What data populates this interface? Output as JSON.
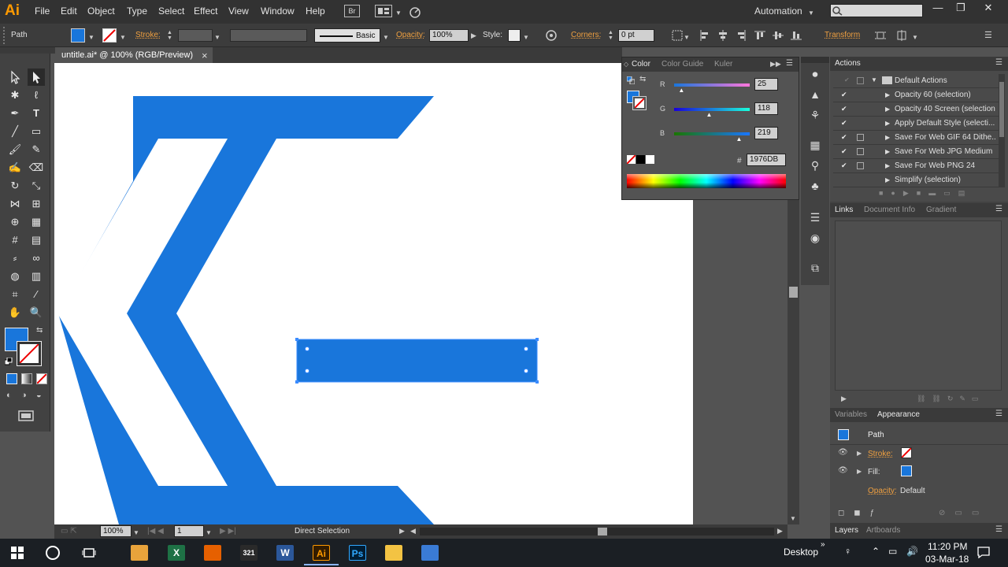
{
  "app": {
    "logo": "Ai",
    "menus": [
      "File",
      "Edit",
      "Object",
      "Type",
      "Select",
      "Effect",
      "View",
      "Window",
      "Help"
    ],
    "bridge_label": "Br",
    "workspace": "Automation",
    "win_controls": [
      "—",
      "❐",
      "✕"
    ]
  },
  "control_bar": {
    "selection_type": "Path",
    "stroke_label": "Stroke:",
    "brush_label": "Basic",
    "opacity_label": "Opacity:",
    "opacity_value": "100%",
    "style_label": "Style:",
    "corners_label": "Corners:",
    "corners_value": "0 pt",
    "transform_label": "Transform"
  },
  "document": {
    "tab_title": "untitle.ai* @ 100% (RGB/Preview)",
    "close_label": "×"
  },
  "status": {
    "zoom": "100%",
    "artboard": "1",
    "tool": "Direct Selection"
  },
  "color_panel": {
    "tabs": [
      "Color",
      "Color Guide",
      "Kuler"
    ],
    "channels": [
      {
        "label": "R",
        "value": "25",
        "fraction": 0.098
      },
      {
        "label": "G",
        "value": "118",
        "fraction": 0.463
      },
      {
        "label": "B",
        "value": "219",
        "fraction": 0.859
      }
    ],
    "hex_symbol": "#",
    "hex_value": "1976DB"
  },
  "actions_panel": {
    "title": "Actions",
    "set_name": "Default Actions",
    "items": [
      "Opacity 60 (selection)",
      "Opacity 40 Screen (selection)",
      "Apply Default Style (selecti...",
      "Save For Web GIF 64 Dithe...",
      "Save For Web JPG Medium",
      "Save For Web PNG 24",
      "Simplify (selection)"
    ]
  },
  "links_panel": {
    "tabs": [
      "Links",
      "Document Info",
      "Gradient"
    ]
  },
  "appearance_panel": {
    "tabs": [
      "Variables",
      "Appearance"
    ],
    "object": "Path",
    "stroke_label": "Stroke:",
    "fill_label": "Fill:",
    "opacity_label": "Opacity:",
    "opacity_value": "Default"
  },
  "layers_panel": {
    "tabs": [
      "Layers",
      "Artboards"
    ]
  },
  "taskbar": {
    "desktop_label": "Desktop",
    "time": "11:20 PM",
    "date": "03-Mar-18",
    "apps": [
      {
        "name": "chrome",
        "label": "",
        "color": "#e8a33b"
      },
      {
        "name": "excel",
        "label": "X",
        "color": "#1e7145"
      },
      {
        "name": "firefox",
        "label": "",
        "color": "#e66000"
      },
      {
        "name": "media",
        "label": "321",
        "color": "#2a2a2a"
      },
      {
        "name": "word",
        "label": "W",
        "color": "#2b579a"
      },
      {
        "name": "illustrator",
        "label": "Ai",
        "color": "#331c00"
      },
      {
        "name": "photoshop",
        "label": "Ps",
        "color": "#001d34"
      },
      {
        "name": "explorer",
        "label": "",
        "color": "#f3c343"
      },
      {
        "name": "other",
        "label": "",
        "color": "#3a7bd5"
      }
    ]
  },
  "colors": {
    "fill": "#1976DB",
    "ui_accent": "#f0a040"
  }
}
